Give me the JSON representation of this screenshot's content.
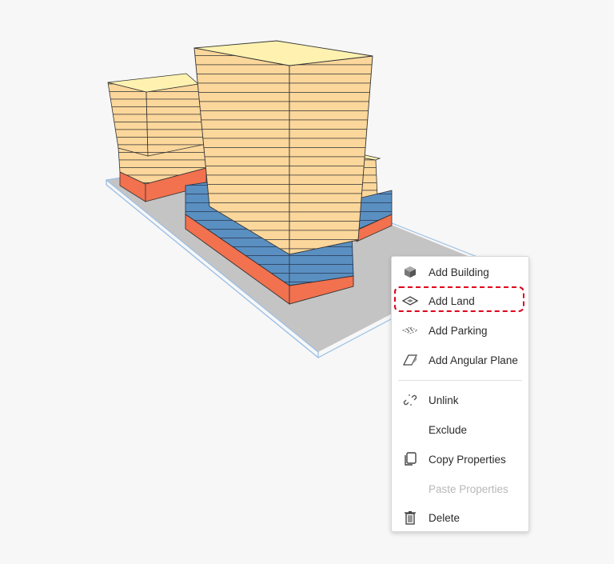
{
  "context_menu": {
    "items": [
      {
        "label": "Add Building",
        "icon": "cube-icon",
        "enabled": true
      },
      {
        "label": "Add Land",
        "icon": "land-plane-icon",
        "enabled": true,
        "highlighted": true
      },
      {
        "label": "Add Parking",
        "icon": "parking-icon",
        "enabled": true
      },
      {
        "label": "Add Angular Plane",
        "icon": "angular-plane-icon",
        "enabled": true
      },
      {
        "label": "Unlink",
        "icon": "broken-link-icon",
        "enabled": true
      },
      {
        "label": "Exclude",
        "icon": "",
        "enabled": true
      },
      {
        "label": "Copy Properties",
        "icon": "copy-icon",
        "enabled": true
      },
      {
        "label": "Paste Properties",
        "icon": "",
        "enabled": false
      },
      {
        "label": "Delete",
        "icon": "trash-icon",
        "enabled": true
      }
    ]
  },
  "colors": {
    "residential_floor": "#fcd79b",
    "roof": "#fff2b0",
    "podium_blue": "#5a8fc2",
    "retail_orange": "#f2714f",
    "land": "#c4c4c4",
    "site_outline": "#9cc0e6",
    "highlight_dash": "#e0001b"
  }
}
